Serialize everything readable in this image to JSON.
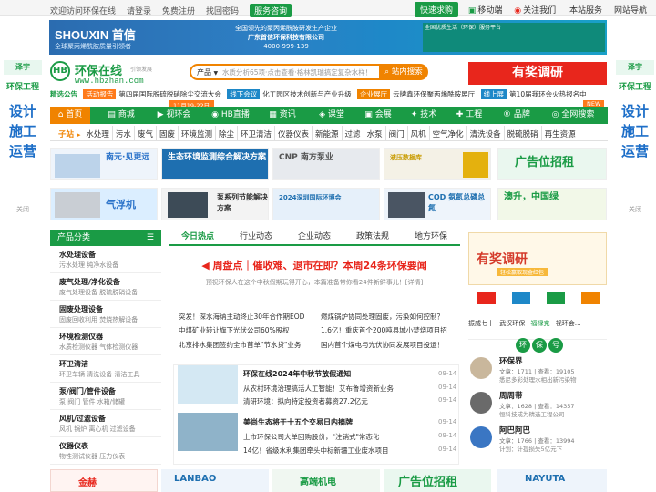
{
  "topbar": {
    "welcome": "欢迎访问环保在线",
    "login": "请登录",
    "register": "免费注册",
    "findpwd": "找回密码",
    "service_btn": "服务咨询",
    "join_btn": "快速求购",
    "mobile": "移动端",
    "follow": "关注我们",
    "site_service": "本站服务",
    "site_nav": "网站导航"
  },
  "banner": {
    "brand": "SHOUXIN 首信",
    "brand_sub": "全球聚丙烯酰胺质量引领者",
    "mid_line1": "全国领先的聚丙烯酰胺研发生产企业",
    "mid_line2": "广东首信环保科技有限公司",
    "mid_line3": "4000-999-139",
    "right_text": "全国优质生活（环保）服务平台"
  },
  "left_side": {
    "logo": "泽宇",
    "label": "环保工程",
    "big": [
      "设计",
      "施工",
      "运营"
    ],
    "close": "关闭"
  },
  "right_side": {
    "logo": "泽宇",
    "label": "环保工程",
    "big": [
      "设计",
      "施工",
      "运营"
    ],
    "close": "关闭"
  },
  "header": {
    "logo_mark": "HB",
    "logo_title": "环保在线",
    "logo_slogan": "引领发展",
    "logo_url": "www.hbzhan.com",
    "search_cat": "产品",
    "search_placeholder": "水质分析65项·点击查看·格林凯瑞搞定复杂水样！",
    "search_btn": "站内搜索",
    "red_ad": "有奖调研"
  },
  "ticker": [
    {
      "tag": "活动报告",
      "color": "#ff7a1a",
      "text": "第四届国际脱硫脱硝除尘交流大会"
    },
    {
      "tag": "线下会议",
      "color": "#1e88c8",
      "text": "化工园区技术创新与产业升级"
    },
    {
      "tag": "企业展厅",
      "color": "#f08300",
      "text": "云牌鑫环保聚丙烯酰胺展厅"
    },
    {
      "tag": "线上展",
      "color": "#1e88c8",
      "text": "第10届我环会火热报名中"
    }
  ],
  "ticker_head": "精选公告",
  "ticker_date": "11月19-22日",
  "new_tag": "NEW",
  "nav": [
    "首页",
    "商城",
    "视环会",
    "HB直播",
    "资讯",
    "课堂",
    "会展",
    "技术",
    "工程",
    "品牌",
    "全网搜索"
  ],
  "subnav": {
    "head": "子站",
    "items": [
      "水处理",
      "污水",
      "废气",
      "固废",
      "环境监测",
      "除尘",
      "环卫清洁",
      "仪器仪表",
      "新能源",
      "过滤",
      "水泵",
      "阀门",
      "风机",
      "空气净化",
      "清洗设备",
      "脱硫脱硝",
      "再生资源"
    ]
  },
  "ads_row1": [
    {
      "text": "南元·见更远",
      "color": "#2a72c9"
    },
    {
      "text": "生态环境监测综合解决方案",
      "color": "#1e6fb0"
    },
    {
      "text": "CNP 南方泵业",
      "color": "#555"
    },
    {
      "text": "液压数据库",
      "color": "#c89b00"
    },
    {
      "text": "广告位招租",
      "color": "#1a9b45"
    }
  ],
  "ads_row2": [
    {
      "text": "气浮机",
      "color": "#2a72c9"
    },
    {
      "text": "泵系列节能解决方案",
      "color": "#333"
    },
    {
      "text": "2024深圳国际环博会",
      "color": "#1e6fb0"
    },
    {
      "text": "COD 氨氮总磷总氮",
      "color": "#1e6fb0"
    },
    {
      "text": "澳升，中国绿",
      "color": "#1a9b45"
    }
  ],
  "sidebar": {
    "title": "产品分类",
    "sections": [
      {
        "title": "水处理设备",
        "sub": "污水处理   纯净水设备"
      },
      {
        "title": "废气处理/净化设备",
        "sub": "废气处理设备   脱硫脱硝设备"
      },
      {
        "title": "固废处理设备",
        "sub": "固废回收利用   焚烧热解设备"
      },
      {
        "title": "环境检测仪器",
        "sub": "水质检测仪器   气体检测仪器"
      },
      {
        "title": "环卫清洁",
        "sub": "环卫车辆   清洗设备   清洁工具"
      },
      {
        "title": "泵/阀门/管件设备",
        "sub": "泵   阀门   管件   水箱/储罐"
      },
      {
        "title": "风机/过滤设备",
        "sub": "风机   锅炉   离心机   过滤设备"
      },
      {
        "title": "仪器仪表",
        "sub": "物性测试仪器   压力仪表"
      }
    ]
  },
  "tabs": [
    "今日热点",
    "行业动态",
    "企业动态",
    "政策法规",
    "地方环保"
  ],
  "headline": {
    "title": "周盘点｜催收难、退市在即？本周24条环保要闻",
    "desc": "预祝环保人在这个中秋假期玩得开心，本篇准备带你看24件新鲜事儿！[详情]"
  },
  "news_left": [
    "突发！深水海纳主动终止30年合作期EOD",
    "中煤矿业转让旗下光伏公司60%股权",
    "北京排水集团签约全市首单\"节水贷\"业务"
  ],
  "news_right": [
    "燃煤锅炉协同处理固废，污染如何控制？",
    "1.6亿！重庆首个200吨县城小焚烧项目招",
    "国内首个煤电与光伏协同发展项目投运！"
  ],
  "feat1": {
    "title": "环保在线2024年中秋节放假通知",
    "date": "09-14",
    "items": [
      {
        "text": "从农村环境治理搞活人工智能！艾布鲁增资新业务",
        "date": "09-14"
      },
      {
        "text": "清研环境：拟向特定投资者募资27.2亿元",
        "date": "09-14"
      }
    ]
  },
  "feat2": {
    "title": "美尚生态将于十五个交易日内摘牌",
    "date": "09-14",
    "items": [
      {
        "text": "上市环保公司大单回购股份，\"注销式\"常态化",
        "date": "09-14"
      },
      {
        "text": "14亿！省级水利集团牵头中标新疆工业废水项目",
        "date": "09-14"
      }
    ]
  },
  "right": {
    "ad_title": "有奖调研",
    "ad_sub": "轻松赢取现金红包",
    "expo_labels": [
      "振威七十",
      "武汉环保",
      "福禄克",
      "视环会…"
    ],
    "bao_chars": [
      "环",
      "保",
      "号"
    ],
    "experts": [
      {
        "name": "环保界",
        "meta": "文章：1711 | 查看：19105",
        "bio": "悉尼多彩处理水相出新污染物"
      },
      {
        "name": "周周带",
        "meta": "文章：1628 | 查看：14357",
        "bio": "恒科技成为精选工程公司"
      },
      {
        "name": "阿巴阿巴",
        "meta": "文章：1766 | 查看：13994",
        "bio": "计划：计提损失5亿元下"
      }
    ]
  },
  "bottom_ads": [
    {
      "text": "金赫",
      "color": "#e8261c"
    },
    {
      "text": "LANBAO",
      "color": "#1e6fb0"
    },
    {
      "text": "高端机电",
      "color": "#1a9b45"
    },
    {
      "text": "广告位招租",
      "color": "#1a9b45"
    },
    {
      "text": "NAYUTA",
      "color": "#1e6fb0"
    }
  ],
  "colors": {
    "brand": "#1a9b45",
    "accent": "#f08300",
    "red": "#e8261c"
  }
}
